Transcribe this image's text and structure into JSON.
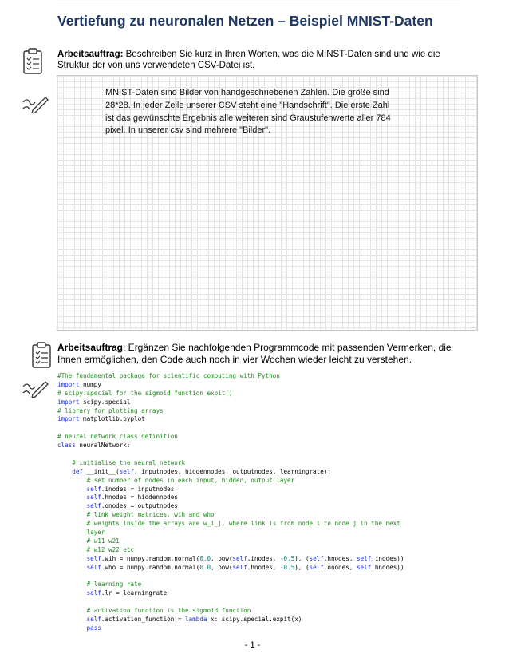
{
  "title": "Vertiefung zu neuronalen Netzen – Beispiel MNIST-Daten",
  "task1": {
    "label": "Arbeitsauftrag:",
    "text_line1": " Beschreiben Sie kurz in Ihren Worten, was die MINST-Daten sind und wie die",
    "text_line2": "Struktur der von uns verwendeten CSV-Datei ist."
  },
  "answer_lines": [
    "MNIST-Daten sind Bilder von handgeschriebenen Zahlen. Die größe sind",
    "28*28. In jeder Zeile unserer CSV steht eine \"Handschrift\". Die erste Zahl",
    "ist das gewünschte Ergebnis alle weiteren sind Graustufenwerte aller 784",
    "pixel. In unserer csv sind mehrere \"Bilder\"."
  ],
  "task2": {
    "label": "Arbeitsauftrag",
    "text_line1": ": Ergänzen Sie nachfolgenden Programmcode mit passenden Vermerken, die",
    "text_line2": "Ihnen ermöglichen, den Code auch noch in vier Wochen wieder leicht zu verstehen."
  },
  "code_lines": [
    "#The fundamental package for scientific computing with Python",
    "import numpy",
    "# scipy.special for the sigmoid function expit()",
    "import scipy.special",
    "# library for plotting arrays",
    "import matplotlib.pyplot",
    "",
    "# neural network class definition",
    "class neuralNetwork:",
    "",
    "    # initialise the neural network",
    "    def __init__(self, inputnodes, hiddennodes, outputnodes, learningrate):",
    "        # set number of nodes in each input, hidden, output layer",
    "        self.inodes = inputnodes",
    "        self.hnodes = hiddennodes",
    "        self.onodes = outputnodes",
    "        # link weight matrices, wih and who",
    "        # weights inside the arrays are w_i_j, where link is from node i to node j in the next",
    "        layer",
    "        # w11 w21",
    "        # w12 w22 etc",
    "        self.wih = numpy.random.normal(0.0, pow(self.inodes, -0.5), (self.hnodes, self.inodes))",
    "        self.who = numpy.random.normal(0.0, pow(self.hnodes, -0.5), (self.onodes, self.hnodes))",
    "",
    "        # learning rate",
    "        self.lr = learningrate",
    "",
    "        # activation function is the sigmoid function",
    "        self.activation_function = lambda x: scipy.special.expit(x)",
    "        pass"
  ],
  "footer": "- 1 -",
  "colors": {
    "title": "#1f3864",
    "comment": "#218a1f",
    "keyword": "#1a2fd6",
    "number": "#0a7f7f"
  },
  "icons": [
    "checklist-icon",
    "pen-icon"
  ]
}
